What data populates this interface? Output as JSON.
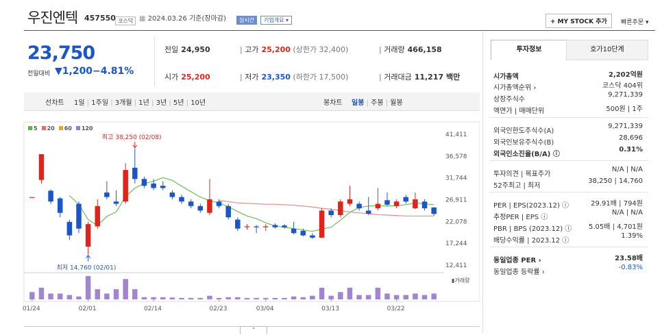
{
  "header": {
    "name": "우진엔텍",
    "code": "457550",
    "market_badge": "코스닥",
    "date_text": "2024.03.26 기준(장마감)",
    "live_label": "실시간",
    "corp_label": "기업개요 ▾",
    "mystock_label": "+ MY STOCK 추가",
    "quick_label": "빠른주문 ▾"
  },
  "price": {
    "current": "23,750",
    "change_label": "전일대비",
    "change": "▼1,200",
    "change_pct": "−4.81%"
  },
  "stats": {
    "prev_label": "전일",
    "prev": "24,950",
    "high_label": "고가",
    "high": "25,200",
    "high_limit": "(상한가 32,400)",
    "volume_label": "거래량",
    "volume": "466,158",
    "open_label": "시가",
    "open": "25,200",
    "low_label": "저가",
    "low": "23,350",
    "low_limit": "(하한가 17,500)",
    "amount_label": "거래대금",
    "amount": "11,217 백만"
  },
  "periods": {
    "line_label": "선차트",
    "line_items": [
      "1일",
      "1주일",
      "3개월",
      "1년",
      "3년",
      "5년",
      "10년"
    ],
    "candle_label": "봉차트",
    "candle_items": [
      "일봉",
      "주봉",
      "월봉"
    ],
    "candle_active": "일봉"
  },
  "panel": {
    "tabs": [
      "투자정보",
      "호가10단계"
    ],
    "rows1": [
      {
        "label": "시가총액",
        "value": "2,202억원",
        "bold": true
      },
      {
        "label": "시가총액순위 ›",
        "value": "코스닥 404위"
      },
      {
        "label": "상장주식수",
        "value": "9,271,339"
      },
      {
        "label": "액면가 | 매매단위",
        "value": "500원 | 1주"
      }
    ],
    "rows2": [
      {
        "label": "외국인한도주식수(A)",
        "value": "9,271,339"
      },
      {
        "label": "외국인보유주식수(B)",
        "value": "28,696"
      },
      {
        "label": "외국인소진율(B/A) ⓘ",
        "value": "0.31%",
        "bold": true
      }
    ],
    "rows3": [
      {
        "label": "투자의견 | 목표주가",
        "value": "N/A | N/A"
      },
      {
        "label": "52주최고 | 최저",
        "value": "38,250 | 14,760"
      }
    ],
    "rows4": [
      {
        "label": "PER | EPS(2023.12) ⓘ",
        "value": "29.91배 | 794원"
      },
      {
        "label": "추정PER | EPS ⓘ",
        "value": "N/A | N/A"
      },
      {
        "label": "PBR | BPS (2023.12) ⓘ",
        "value": "5.05배 | 4,701원"
      },
      {
        "label": "배당수익률 | 2023.12 ⓘ",
        "value": "1.39%"
      }
    ],
    "rows5": [
      {
        "label": "동일업종 PER ›",
        "value": "23.58배",
        "bold": true
      },
      {
        "label": "동일업종 등락률 ›",
        "value": "-0.83%",
        "blue": true
      }
    ]
  },
  "chart_data": {
    "type": "candlestick",
    "legend": [
      {
        "name": "5",
        "color": "#58b848"
      },
      {
        "name": "20",
        "color": "#e86a6a"
      },
      {
        "name": "60",
        "color": "#e8a030"
      },
      {
        "name": "120",
        "color": "#9a7ad0"
      }
    ],
    "y_ticks": [
      "41,411",
      "36,578",
      "31,744",
      "26,911",
      "22,078",
      "17,244",
      "12,411"
    ],
    "ylim": [
      12411,
      41411
    ],
    "x_ticks": [
      "01/24",
      "02/01",
      "02/14",
      "02/23",
      "03/04",
      "03/13",
      "03/22"
    ],
    "x_tick_index": [
      0,
      6,
      13,
      20,
      25,
      32,
      39
    ],
    "max_annotation": "최고 38,250 (02/08)",
    "min_annotation": "최저 14,760 (02/01)",
    "volume_label": "거래량",
    "candles": [
      {
        "o": 27500,
        "c": 27500,
        "h": 27500,
        "l": 27500
      },
      {
        "o": 31300,
        "c": 37000,
        "h": 37000,
        "l": 30500
      },
      {
        "o": 28900,
        "c": 26500,
        "h": 29200,
        "l": 26000
      },
      {
        "o": 27200,
        "c": 24000,
        "h": 27500,
        "l": 23000
      },
      {
        "o": 22000,
        "c": 19000,
        "h": 22500,
        "l": 18000
      },
      {
        "o": 26000,
        "c": 20500,
        "h": 26500,
        "l": 19500
      },
      {
        "o": 16500,
        "c": 21500,
        "h": 22000,
        "l": 14760
      },
      {
        "o": 21000,
        "c": 25500,
        "h": 27000,
        "l": 20500
      },
      {
        "o": 28500,
        "c": 27500,
        "h": 31000,
        "l": 27000
      },
      {
        "o": 26500,
        "c": 26000,
        "h": 29000,
        "l": 25500
      },
      {
        "o": 26500,
        "c": 33500,
        "h": 35000,
        "l": 26000
      },
      {
        "o": 34000,
        "c": 31500,
        "h": 38250,
        "l": 30500
      },
      {
        "o": 31500,
        "c": 30000,
        "h": 32000,
        "l": 29500
      },
      {
        "o": 30500,
        "c": 29500,
        "h": 31500,
        "l": 29000
      },
      {
        "o": 30000,
        "c": 29500,
        "h": 31000,
        "l": 29000
      },
      {
        "o": 28500,
        "c": 27500,
        "h": 29000,
        "l": 27000
      },
      {
        "o": 27500,
        "c": 26500,
        "h": 28000,
        "l": 26000
      },
      {
        "o": 26500,
        "c": 25500,
        "h": 27000,
        "l": 25000
      },
      {
        "o": 25500,
        "c": 24500,
        "h": 26000,
        "l": 24000
      },
      {
        "o": 24000,
        "c": 27000,
        "h": 31500,
        "l": 23500
      },
      {
        "o": 26500,
        "c": 25500,
        "h": 27000,
        "l": 25000
      },
      {
        "o": 25500,
        "c": 23000,
        "h": 26000,
        "l": 22500
      },
      {
        "o": 22500,
        "c": 20500,
        "h": 23000,
        "l": 20000
      },
      {
        "o": 21000,
        "c": 21000,
        "h": 21500,
        "l": 20300
      },
      {
        "o": 21000,
        "c": 20800,
        "h": 21300,
        "l": 19500
      },
      {
        "o": 20800,
        "c": 21000,
        "h": 21500,
        "l": 20000
      },
      {
        "o": 21300,
        "c": 20800,
        "h": 21700,
        "l": 20500
      },
      {
        "o": 21200,
        "c": 20800,
        "h": 21500,
        "l": 20500
      },
      {
        "o": 20500,
        "c": 19500,
        "h": 22000,
        "l": 19200
      },
      {
        "o": 20000,
        "c": 19000,
        "h": 20500,
        "l": 18800
      },
      {
        "o": 19000,
        "c": 18500,
        "h": 19500,
        "l": 18200
      },
      {
        "o": 18500,
        "c": 24500,
        "h": 25000,
        "l": 18500
      },
      {
        "o": 24500,
        "c": 23500,
        "h": 25000,
        "l": 23000
      },
      {
        "o": 23500,
        "c": 26500,
        "h": 27000,
        "l": 23000
      },
      {
        "o": 26000,
        "c": 27000,
        "h": 30000,
        "l": 25500
      },
      {
        "o": 26000,
        "c": 25000,
        "h": 26500,
        "l": 24500
      },
      {
        "o": 24500,
        "c": 23800,
        "h": 27500,
        "l": 23500
      },
      {
        "o": 25000,
        "c": 26000,
        "h": 29500,
        "l": 24500
      },
      {
        "o": 26800,
        "c": 25800,
        "h": 28500,
        "l": 25500
      },
      {
        "o": 25500,
        "c": 26500,
        "h": 27000,
        "l": 25000
      },
      {
        "o": 27500,
        "c": 26500,
        "h": 28000,
        "l": 26000
      },
      {
        "o": 25000,
        "c": 27000,
        "h": 28500,
        "l": 24800
      },
      {
        "o": 26500,
        "c": 25000,
        "h": 27000,
        "l": 24500
      },
      {
        "o": 25200,
        "c": 23750,
        "h": 25200,
        "l": 23350
      }
    ],
    "ma5": [
      null,
      null,
      null,
      null,
      27800,
      25900,
      22500,
      21200,
      23200,
      24200,
      27600,
      29500,
      30500,
      31000,
      31800,
      31200,
      29900,
      28700,
      27500,
      26700,
      26200,
      25400,
      24300,
      23300,
      22700,
      21800,
      21100,
      20800,
      20500,
      20200,
      19900,
      20400,
      20800,
      22400,
      24100,
      25200,
      25500,
      25600,
      25500,
      25600,
      25800,
      26200,
      26000,
      25800
    ],
    "ma20": [
      null,
      null,
      null,
      null,
      null,
      null,
      null,
      null,
      null,
      null,
      null,
      null,
      null,
      null,
      null,
      null,
      null,
      null,
      null,
      null,
      26700,
      26500,
      26200,
      26100,
      26000,
      25900,
      25900,
      25800,
      25700,
      25500,
      25300,
      25000,
      24800,
      24500,
      24200,
      24000,
      23800,
      23600,
      23500,
      23400,
      23300,
      23300,
      23300,
      23300
    ],
    "volume": [
      5,
      8,
      4,
      4,
      3,
      2,
      16,
      7,
      4,
      7,
      14,
      7,
      1.5,
      1.5,
      1.5,
      1.3,
      1,
      1,
      1,
      2.5,
      1,
      1.5,
      1.5,
      1,
      1,
      1,
      1,
      1,
      2,
      1.5,
      2.5,
      8,
      2.5,
      5,
      8,
      3,
      3,
      8,
      4,
      3,
      3,
      4,
      3,
      4
    ]
  }
}
